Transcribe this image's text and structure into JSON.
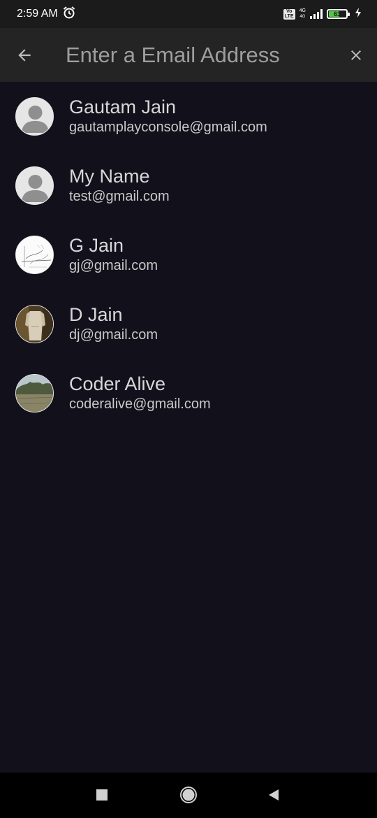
{
  "status_bar": {
    "time": "2:59 AM",
    "alarm_icon": "alarm-icon",
    "volte_top": "Vo",
    "volte_bottom": "LTE",
    "network_type": "4G",
    "network_sub": "4G",
    "battery_level": "63",
    "battery_percent": 63,
    "charging_icon": "bolt-icon"
  },
  "app_bar": {
    "back_icon": "arrow-back-icon",
    "search_placeholder": "Enter a Email Address",
    "search_value": "",
    "close_icon": "close-icon"
  },
  "accounts": [
    {
      "name": "Gautam Jain",
      "email": "gautamplayconsole@gmail.com",
      "avatar": "default-person-avatar"
    },
    {
      "name": "My Name",
      "email": "test@gmail.com",
      "avatar": "default-person-avatar"
    },
    {
      "name": "G Jain",
      "email": "gj@gmail.com",
      "avatar": "sketch-photo-avatar"
    },
    {
      "name": "D Jain",
      "email": "dj@gmail.com",
      "avatar": "clothing-photo-avatar"
    },
    {
      "name": "Coder Alive",
      "email": "coderalive@gmail.com",
      "avatar": "landscape-photo-avatar"
    }
  ],
  "nav_bar": {
    "recents_icon": "square-icon",
    "home_icon": "circle-icon",
    "back_icon": "triangle-back-icon"
  },
  "colors": {
    "background": "#12101b",
    "app_bar": "#242424",
    "status_bar": "#1b1b1b",
    "battery": "#4ccb3f",
    "name_text": "#d7d7d7",
    "email_text": "#c9c9c9"
  }
}
